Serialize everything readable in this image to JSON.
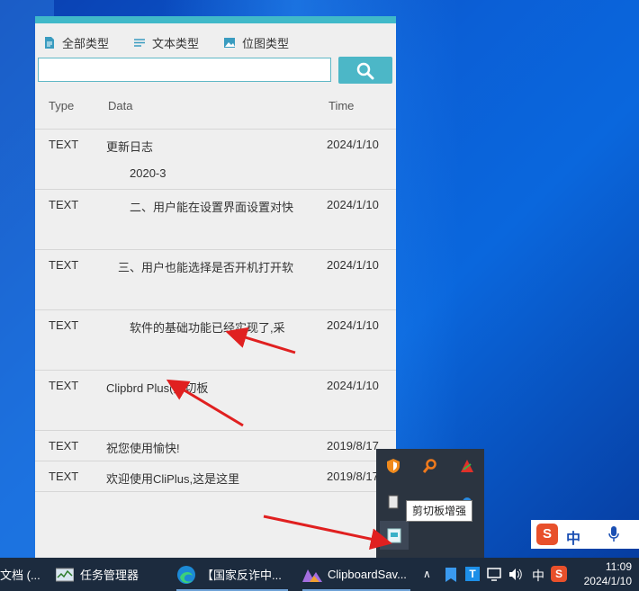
{
  "app": {
    "type_buttons": [
      {
        "label": "全部类型",
        "icon": "document-icon"
      },
      {
        "label": "文本类型",
        "icon": "text-lines-icon"
      },
      {
        "label": "位图类型",
        "icon": "image-icon"
      }
    ],
    "search": {
      "value": "",
      "placeholder": ""
    },
    "columns": {
      "type": "Type",
      "data": "Data",
      "time": "Time"
    },
    "rows": [
      {
        "type": "TEXT",
        "data": "更新日志",
        "data2": "2020-3",
        "time": "2024/1/10"
      },
      {
        "type": "TEXT",
        "data": "二、用户能在设置界面设置对快",
        "data2": "",
        "time": "2024/1/10"
      },
      {
        "type": "TEXT",
        "data": "三、用户也能选择是否开机打开软",
        "data2": "",
        "time": "2024/1/10"
      },
      {
        "type": "TEXT",
        "data": "软件的基础功能已经实现了,采",
        "data2": "",
        "time": "2024/1/10"
      },
      {
        "type": "TEXT",
        "data": "Clipbrd Plus(剪切板",
        "data2": "",
        "time": "2024/1/10"
      },
      {
        "type": "TEXT",
        "data": "祝您使用愉快!",
        "data2": "",
        "time": "2019/8/17"
      },
      {
        "type": "TEXT",
        "data": "欢迎使用CliPlus,这是这里",
        "data2": "",
        "time": "2019/8/17"
      }
    ]
  },
  "tray": {
    "tooltip": "剪切板增强"
  },
  "ime": {
    "logo": "S",
    "mode": "中"
  },
  "taskbar": {
    "items": [
      {
        "label": "文档 (..."
      },
      {
        "label": "任务管理器"
      },
      {
        "label": "【国家反诈中..."
      },
      {
        "label": "ClipboardSav..."
      }
    ],
    "lang": "中",
    "time": "11:09",
    "date": "2024/1/10"
  },
  "colors": {
    "accent": "#4cb7c7",
    "arrow": "#e02020",
    "taskbar": "#1c2b3e"
  }
}
